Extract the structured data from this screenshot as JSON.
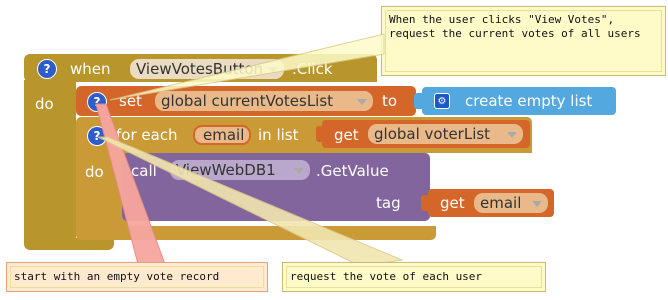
{
  "event": {
    "when_label": "when",
    "component": "ViewVotesButton",
    "event_name": ".Click",
    "do_label": "do"
  },
  "set_block": {
    "set_label": "set",
    "variable": "global currentVotesList",
    "to_label": "to"
  },
  "create_list": {
    "label": "create empty list"
  },
  "foreach": {
    "for_each_label": "for each",
    "item_var": "email",
    "in_list_label": "in list",
    "do_label": "do"
  },
  "get_voter": {
    "get_label": "get",
    "variable": "global voterList"
  },
  "call_block": {
    "call_label": "call",
    "component": "ViewWebDB1",
    "method": ".GetValue",
    "tag_label": "tag"
  },
  "get_email": {
    "get_label": "get",
    "variable": "email"
  },
  "comments": {
    "top": "When the user clicks \"View Votes\",\nrequest the current votes of all users",
    "left": "start with an empty vote record",
    "right": "request the vote of each user"
  },
  "colors": {
    "event": "#b8962b",
    "variables": "#d4662a",
    "lists": "#53a8e0",
    "control": "#c99a35",
    "procedure": "#83659e",
    "comment_bg": "#fefbc9"
  }
}
